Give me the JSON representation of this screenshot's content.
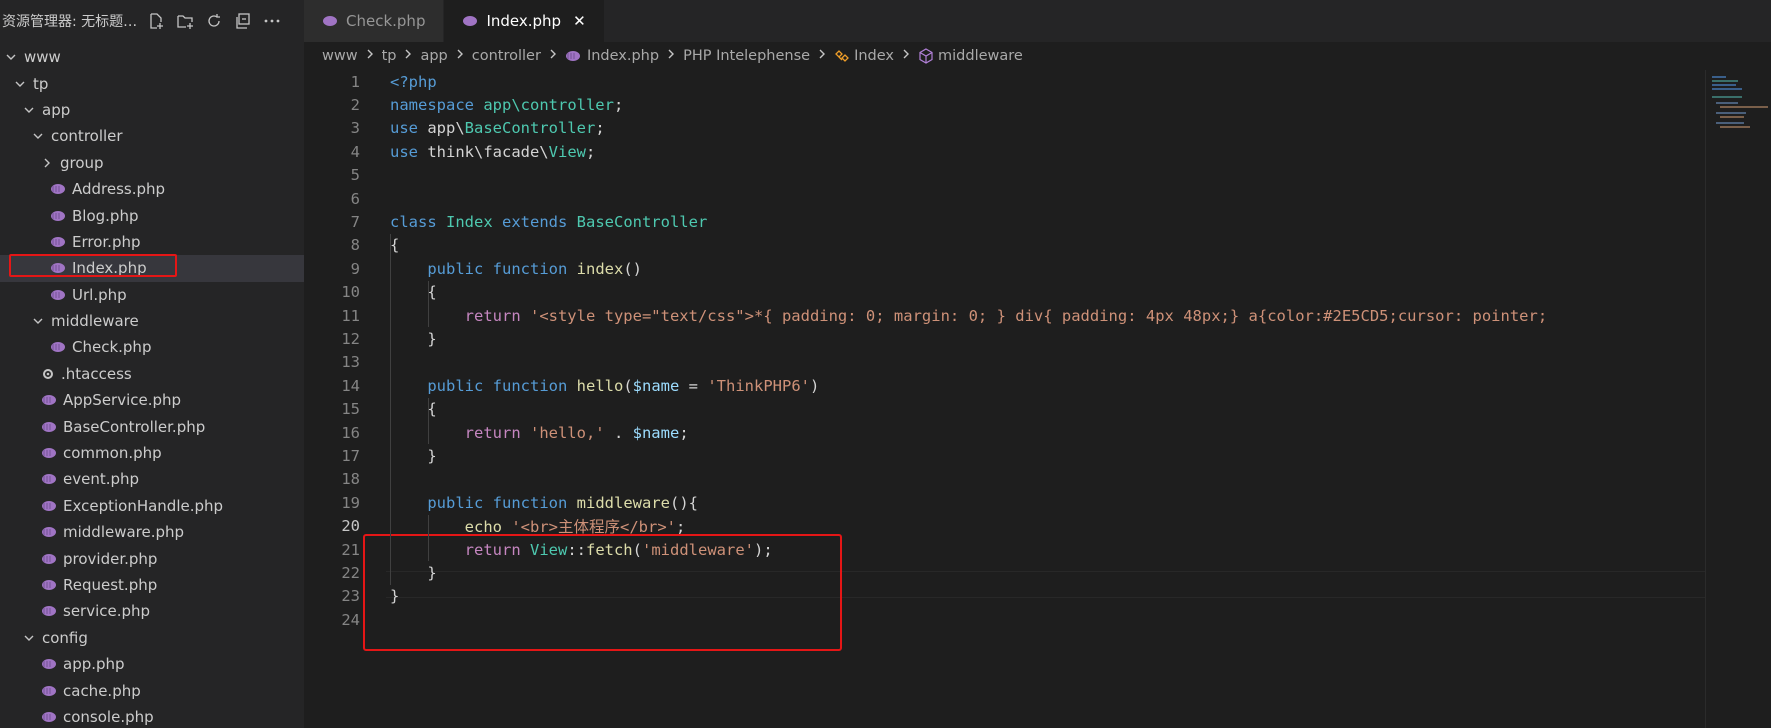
{
  "sidebar": {
    "title": "资源管理器: 无标题 (...",
    "actions": [
      "new-file-icon",
      "new-folder-icon",
      "refresh-icon",
      "collapse-all-icon",
      "more-icon"
    ],
    "tree": [
      {
        "label": "www",
        "depth": 0,
        "type": "folder-open"
      },
      {
        "label": "tp",
        "depth": 1,
        "type": "folder-open"
      },
      {
        "label": "app",
        "depth": 2,
        "type": "folder-open"
      },
      {
        "label": "controller",
        "depth": 3,
        "type": "folder-open"
      },
      {
        "label": "group",
        "depth": 4,
        "type": "folder-closed"
      },
      {
        "label": "Address.php",
        "depth": 4,
        "type": "php"
      },
      {
        "label": "Blog.php",
        "depth": 4,
        "type": "php"
      },
      {
        "label": "Error.php",
        "depth": 4,
        "type": "php"
      },
      {
        "label": "Index.php",
        "depth": 4,
        "type": "php",
        "selected": true
      },
      {
        "label": "Url.php",
        "depth": 4,
        "type": "php"
      },
      {
        "label": "middleware",
        "depth": 3,
        "type": "folder-open"
      },
      {
        "label": "Check.php",
        "depth": 4,
        "type": "php"
      },
      {
        "label": ".htaccess",
        "depth": 3,
        "type": "gear"
      },
      {
        "label": "AppService.php",
        "depth": 3,
        "type": "php"
      },
      {
        "label": "BaseController.php",
        "depth": 3,
        "type": "php"
      },
      {
        "label": "common.php",
        "depth": 3,
        "type": "php"
      },
      {
        "label": "event.php",
        "depth": 3,
        "type": "php"
      },
      {
        "label": "ExceptionHandle.php",
        "depth": 3,
        "type": "php"
      },
      {
        "label": "middleware.php",
        "depth": 3,
        "type": "php"
      },
      {
        "label": "provider.php",
        "depth": 3,
        "type": "php"
      },
      {
        "label": "Request.php",
        "depth": 3,
        "type": "php"
      },
      {
        "label": "service.php",
        "depth": 3,
        "type": "php"
      },
      {
        "label": "config",
        "depth": 2,
        "type": "folder-open"
      },
      {
        "label": "app.php",
        "depth": 3,
        "type": "php"
      },
      {
        "label": "cache.php",
        "depth": 3,
        "type": "php"
      },
      {
        "label": "console.php",
        "depth": 3,
        "type": "php"
      }
    ]
  },
  "tabs": [
    {
      "label": "Check.php",
      "active": false
    },
    {
      "label": "Index.php",
      "active": true,
      "close": "✕"
    }
  ],
  "breadcrumb": [
    "www",
    "tp",
    "app",
    "controller",
    "Index.php",
    "PHP Intelephense",
    "Index",
    "middleware"
  ],
  "editor": {
    "active_line": 20,
    "lines": [
      [
        [
          "kw",
          "<?php"
        ]
      ],
      [
        [
          "kw",
          "namespace "
        ],
        [
          "cls",
          "app\\controller"
        ],
        [
          "pl",
          ";"
        ]
      ],
      [
        [
          "kw",
          "use "
        ],
        [
          "pl",
          "app\\"
        ],
        [
          "cls",
          "BaseController"
        ],
        [
          "pl",
          ";"
        ]
      ],
      [
        [
          "kw",
          "use "
        ],
        [
          "pl",
          "think\\facade\\"
        ],
        [
          "cls",
          "View"
        ],
        [
          "pl",
          ";"
        ]
      ],
      [],
      [],
      [
        [
          "kw",
          "class "
        ],
        [
          "cls",
          "Index "
        ],
        [
          "kw",
          "extends "
        ],
        [
          "cls",
          "BaseController"
        ]
      ],
      [
        [
          "pl",
          "{"
        ]
      ],
      [
        [
          "pl",
          "    "
        ],
        [
          "kw",
          "public "
        ],
        [
          "kw",
          "function "
        ],
        [
          "fn",
          "index"
        ],
        [
          "pl",
          "()"
        ]
      ],
      [
        [
          "pl",
          "    {"
        ]
      ],
      [
        [
          "pl",
          "        "
        ],
        [
          "ctrl",
          "return "
        ],
        [
          "str",
          "'<style type=\"text/css\">*{ padding: 0; margin: 0; } div{ padding: 4px 48px;} a{color:#2E5CD5;cursor: pointer;"
        ]
      ],
      [
        [
          "pl",
          "    }"
        ]
      ],
      [],
      [
        [
          "pl",
          "    "
        ],
        [
          "kw",
          "public "
        ],
        [
          "kw",
          "function "
        ],
        [
          "fn",
          "hello"
        ],
        [
          "pl",
          "("
        ],
        [
          "var",
          "$name"
        ],
        [
          "pl",
          " = "
        ],
        [
          "str",
          "'ThinkPHP6'"
        ],
        [
          "pl",
          ")"
        ]
      ],
      [
        [
          "pl",
          "    {"
        ]
      ],
      [
        [
          "pl",
          "        "
        ],
        [
          "ctrl",
          "return "
        ],
        [
          "str",
          "'hello,'"
        ],
        [
          "pl",
          " . "
        ],
        [
          "var",
          "$name"
        ],
        [
          "pl",
          ";"
        ]
      ],
      [
        [
          "pl",
          "    }"
        ]
      ],
      [],
      [
        [
          "pl",
          "    "
        ],
        [
          "kw",
          "public "
        ],
        [
          "kw",
          "function "
        ],
        [
          "fn",
          "middleware"
        ],
        [
          "pl",
          "(){"
        ]
      ],
      [
        [
          "pl",
          "        "
        ],
        [
          "fn",
          "echo "
        ],
        [
          "str",
          "'<br>主体程序</br>'"
        ],
        [
          "pl",
          ";"
        ]
      ],
      [
        [
          "pl",
          "        "
        ],
        [
          "ctrl",
          "return "
        ],
        [
          "cls",
          "View"
        ],
        [
          "pl",
          "::"
        ],
        [
          "fn",
          "fetch"
        ],
        [
          "pl",
          "("
        ],
        [
          "str",
          "'middleware'"
        ],
        [
          "pl",
          ");"
        ]
      ],
      [
        [
          "pl",
          "    }"
        ]
      ],
      [
        [
          "pl",
          "}"
        ]
      ],
      []
    ]
  }
}
